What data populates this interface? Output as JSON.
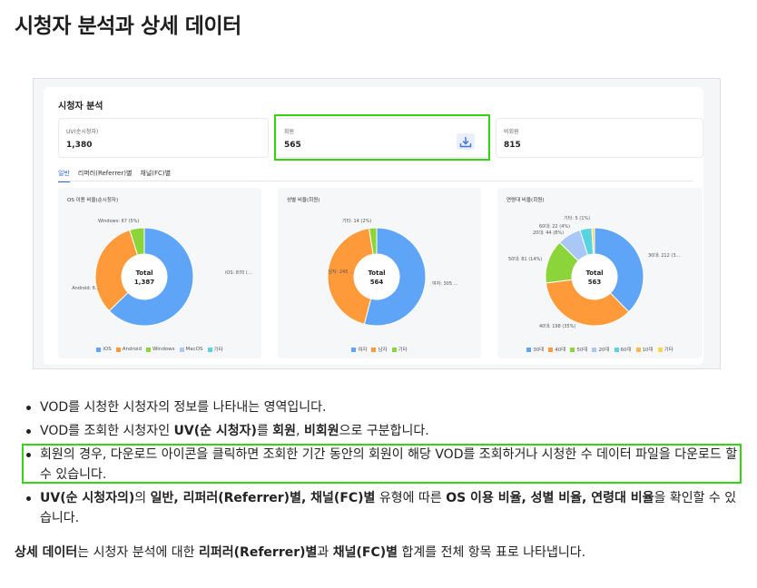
{
  "page_title": "시청자 분석과 상세 데이터",
  "card": {
    "title": "시청자 분석",
    "stats": [
      {
        "label": "UV(순시청자)",
        "value": "1,380"
      },
      {
        "label": "회원",
        "value": "565",
        "icon": "download-icon"
      },
      {
        "label": "비회원",
        "value": "815"
      }
    ],
    "tabs": [
      "일반",
      "리퍼러(Referrer)별",
      "채널(FC)별"
    ],
    "active_tab": "일반",
    "panels": [
      {
        "title": "OS 이용 비율(순시청자)",
        "center_label": "Total",
        "center_value": "1,387",
        "slices": [
          {
            "name": "iOS",
            "value": 870,
            "color": "#5ea5f8"
          },
          {
            "name": "Android",
            "value": 450,
            "color": "#ff9a3a"
          },
          {
            "name": "Windows",
            "value": 67,
            "color": "#8bd43a"
          },
          {
            "name": "MacOS",
            "value": 0,
            "color": "#a9c8f5"
          },
          {
            "name": "기타",
            "value": 0,
            "color": "#5ad3e0"
          }
        ],
        "callouts": [
          "Windows: 67 (5%)",
          "iOS: 870 (…",
          "Android: 6…"
        ],
        "legend": [
          "iOS",
          "Android",
          "Windows",
          "MacOS",
          "기타"
        ]
      },
      {
        "title": "성별 비율(회원)",
        "center_label": "Total",
        "center_value": "564",
        "slices": [
          {
            "name": "여자",
            "value": 305,
            "color": "#5ea5f8"
          },
          {
            "name": "남자",
            "value": 245,
            "color": "#ff9a3a"
          },
          {
            "name": "기타",
            "value": 14,
            "color": "#8bd43a"
          }
        ],
        "callouts": [
          "기타: 14 (2%)",
          "남자: 245 …",
          "여자: 305 …"
        ],
        "legend": [
          "여자",
          "남자",
          "기타"
        ]
      },
      {
        "title": "연령대 비율(회원)",
        "center_label": "Total",
        "center_value": "563",
        "slices": [
          {
            "name": "30대",
            "value": 212,
            "color": "#5ea5f8"
          },
          {
            "name": "40대",
            "value": 198,
            "color": "#ff9a3a"
          },
          {
            "name": "50대",
            "value": 81,
            "color": "#8bd43a"
          },
          {
            "name": "20대",
            "value": 44,
            "color": "#a9c8f5"
          },
          {
            "name": "60대",
            "value": 22,
            "color": "#5ad3e0"
          },
          {
            "name": "10대",
            "value": 0,
            "color": "#ffb84d"
          },
          {
            "name": "기타",
            "value": 5,
            "color": "#ffd54a"
          }
        ],
        "callouts": [
          "기타: 5 (1%)",
          "60대: 22 (4%)",
          "20대: 44 (8%)",
          "50대: 81 (14%)",
          "30대: 212 (3…",
          "40대: 198 (35%)"
        ],
        "legend": [
          "30대",
          "40대",
          "50대",
          "20대",
          "60대",
          "10대",
          "기타"
        ]
      }
    ]
  },
  "bullets": [
    {
      "parts": [
        {
          "t": "VOD를 시청한 시청자의 정보를 나타내는 영역입니다."
        }
      ]
    },
    {
      "parts": [
        {
          "t": "VOD를 조회한 시청자인 "
        },
        {
          "t": "UV(순 시청자)",
          "b": true
        },
        {
          "t": "를 "
        },
        {
          "t": "회원",
          "b": true
        },
        {
          "t": ", "
        },
        {
          "t": "비회원",
          "b": true
        },
        {
          "t": "으로 구분합니다."
        }
      ]
    },
    {
      "parts": [
        {
          "t": "회원의 경우, 다운로드 아이콘을 클릭하면 조회한 기간 동안의 회원이 해당 VOD를 조회하거나 시청한 수 데이터 파일을 다운로드 할 수 있습니다."
        }
      ]
    },
    {
      "parts": [
        {
          "t": "UV(순 시청자의)",
          "b": true
        },
        {
          "t": "의 "
        },
        {
          "t": "일반, 리퍼러(Referrer)별, 채널(FC)별",
          "b": true
        },
        {
          "t": " 유형에 따른 "
        },
        {
          "t": "OS 이용 비율, 성별 비율, 연령대 비율",
          "b": true
        },
        {
          "t": "을 확인할 수 있습니다."
        }
      ]
    }
  ],
  "summary": [
    {
      "t": "상세 데이터",
      "b": true
    },
    {
      "t": "는 시청자 분석에 대한 "
    },
    {
      "t": "리퍼러(Referrer)별",
      "b": true
    },
    {
      "t": "과 "
    },
    {
      "t": "채널(FC)별",
      "b": true
    },
    {
      "t": " 합계를 전체 항목 표로 나타냅니다."
    }
  ]
}
